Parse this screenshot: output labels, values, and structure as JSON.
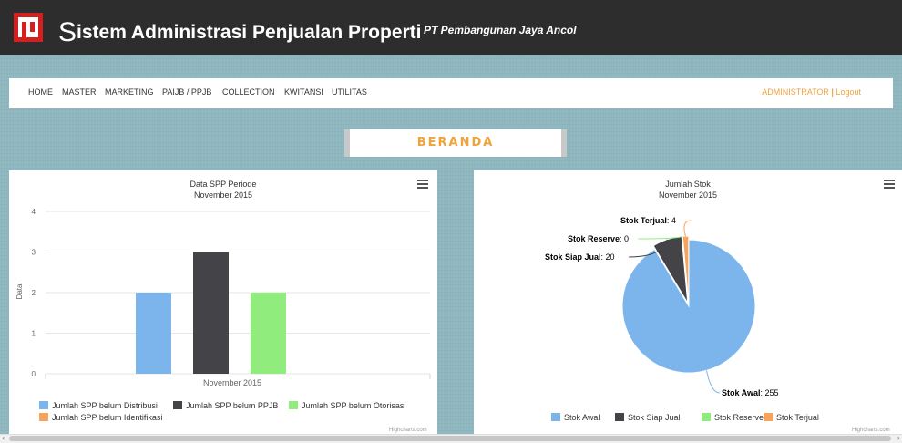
{
  "header": {
    "title_initial": "S",
    "title_rest": "istem Administrasi Penjualan Properti",
    "company": "PT Pembangunan Jaya Ancol",
    "logo_color": "#d21f1f"
  },
  "nav": {
    "items": [
      "HOME",
      "MASTER",
      "MARKETING",
      "PAIJB / PPJB",
      "COLLECTION",
      "KWITANSI",
      "UTILITAS"
    ],
    "user": "ADMINISTRATOR",
    "separator": "|",
    "logout": "Logout",
    "accent": "#f0a23b"
  },
  "page_title": "BERANDA",
  "chart_data": [
    {
      "type": "bar",
      "title": "Data SPP Periode",
      "subtitle": "November 2015",
      "ylabel": "Data",
      "categories": [
        "November 2015"
      ],
      "ylim": [
        0,
        4
      ],
      "yticks": [
        "0",
        "1",
        "2",
        "3",
        "4"
      ],
      "series": [
        {
          "name": "Jumlah SPP belum Distribusi",
          "values": [
            2
          ],
          "color": "#7cb5ec"
        },
        {
          "name": "Jumlah SPP belum PPJB",
          "values": [
            3
          ],
          "color": "#434348"
        },
        {
          "name": "Jumlah SPP belum Otorisasi",
          "values": [
            2
          ],
          "color": "#90ed7d"
        },
        {
          "name": "Jumlah SPP belum Identifikasi",
          "values": [
            0
          ],
          "color": "#f7a35c"
        }
      ],
      "credits": "Highcharts.com",
      "grid": true,
      "legend": "bottom"
    },
    {
      "type": "pie",
      "title": "Jumlah Stok",
      "subtitle": "November 2015",
      "slices": [
        {
          "name": "Stok Awal",
          "value": 255,
          "color": "#7cb5ec"
        },
        {
          "name": "Stok Siap Jual",
          "value": 20,
          "color": "#434348"
        },
        {
          "name": "Stok Reserve",
          "value": 0,
          "color": "#90ed7d"
        },
        {
          "name": "Stok Terjual",
          "value": 4,
          "color": "#f7a35c"
        }
      ],
      "credits": "Highcharts.com",
      "legend": "bottom"
    }
  ]
}
